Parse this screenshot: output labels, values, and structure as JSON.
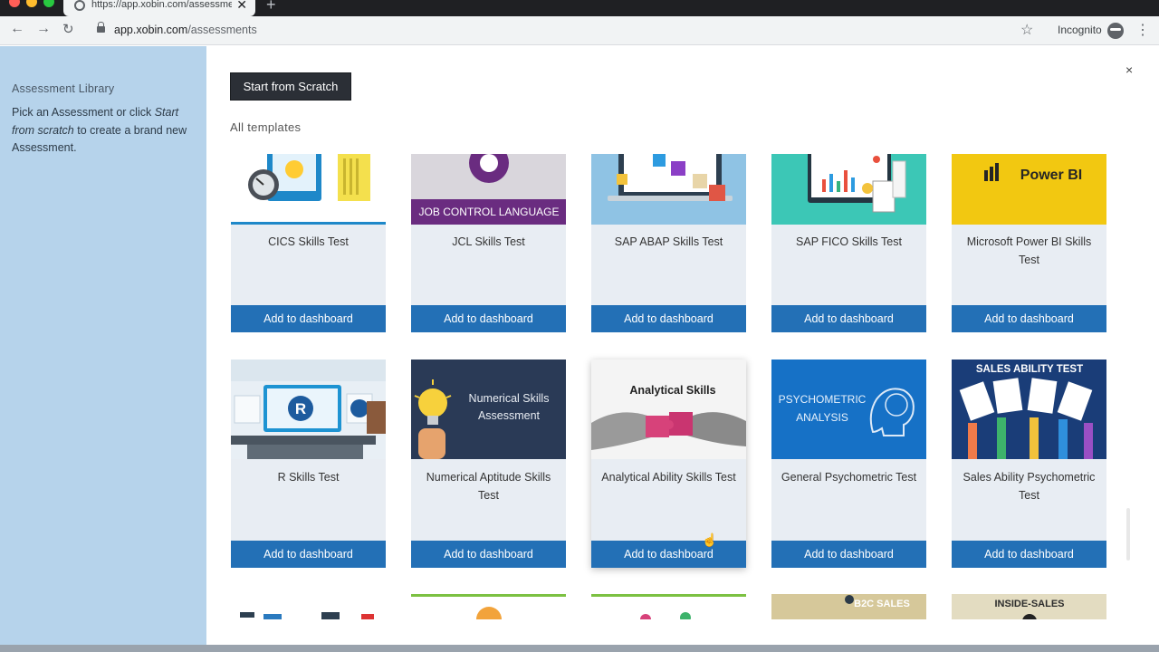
{
  "browser": {
    "tab_title": "https://app.xobin.com/assessme",
    "url_host": "app.xobin.com",
    "url_path": "/assessments",
    "profile_label": "Incognito"
  },
  "sidebar": {
    "title": "Assessment Library",
    "text_before": "Pick an Assessment or click ",
    "text_italic": "Start from scratch",
    "text_after": " to create a brand new Assessment."
  },
  "main": {
    "start_button": "Start from Scratch",
    "section_label": "All templates",
    "close": "×"
  },
  "cards": [
    {
      "name": "CICS Skills Test",
      "button": "Add to dashboard"
    },
    {
      "name": "JCL Skills Test",
      "button": "Add to dashboard",
      "image_text": "JOB CONTROL LANGUAGE"
    },
    {
      "name": "SAP ABAP Skills Test",
      "button": "Add to dashboard"
    },
    {
      "name": "SAP FICO Skills Test",
      "button": "Add to dashboard"
    },
    {
      "name": "Microsoft Power BI Skills Test",
      "button": "Add to dashboard",
      "image_text": "Power BI"
    },
    {
      "name": "R Skills Test",
      "button": "Add to dashboard",
      "image_text": "R"
    },
    {
      "name": "Numerical Aptitude Skills Test",
      "button": "Add to dashboard",
      "image_text": "Numerical Skills Assessment"
    },
    {
      "name": "Analytical Ability Skills Test",
      "button": "Add to dashboard",
      "image_text": "Analytical Skills"
    },
    {
      "name": "General Psychometric Test",
      "button": "Add to dashboard",
      "image_text": "PSYCHOMETRIC ANALYSIS"
    },
    {
      "name": "Sales Ability Psychometric Test",
      "button": "Add to dashboard",
      "image_text": "SALES ABILITY TEST"
    }
  ],
  "partial_cards": [
    {
      "image_text": ""
    },
    {
      "image_text": ""
    },
    {
      "image_text": ""
    },
    {
      "image_text": "B2C SALES"
    },
    {
      "image_text": "INSIDE-SALES"
    }
  ]
}
